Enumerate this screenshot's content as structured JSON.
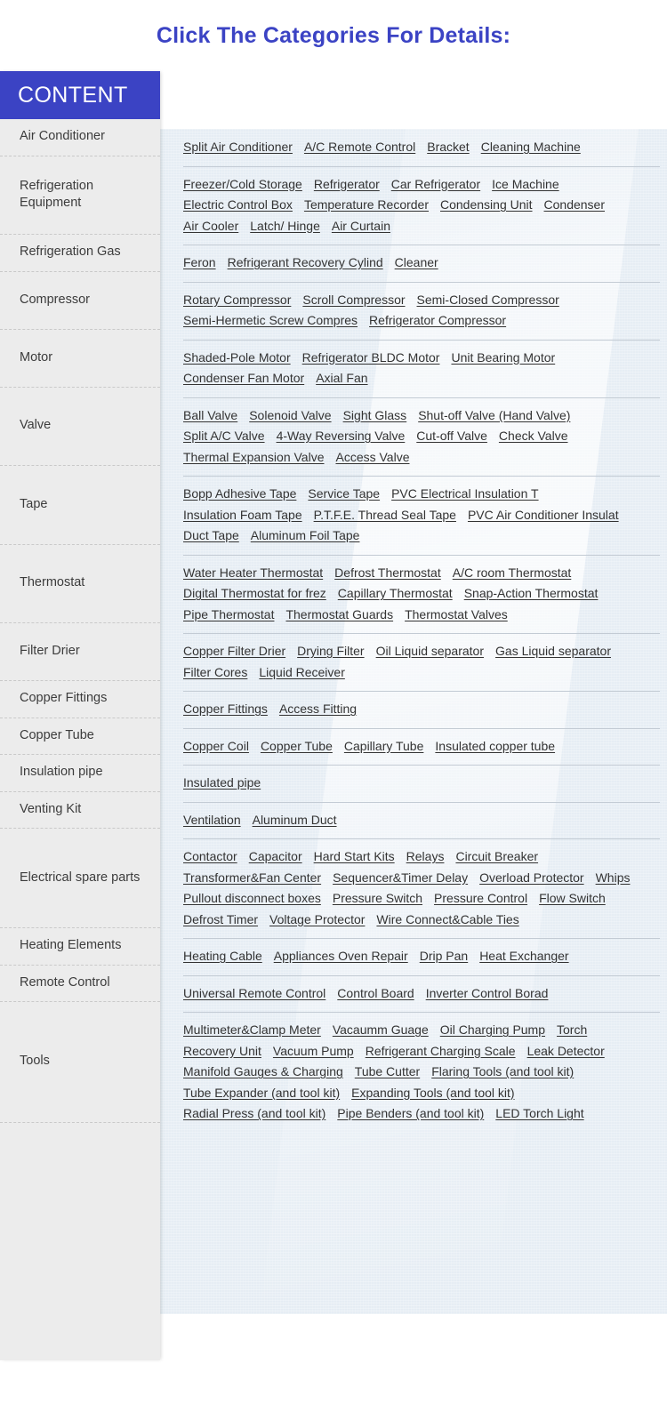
{
  "page": {
    "title": "Click The Categories For Details:",
    "accent_color": "#3b43c4",
    "sidebar_bg": "#ececec",
    "content_bg": "#e6edf4"
  },
  "sidebar": {
    "header": "CONTENT"
  },
  "categories": [
    {
      "label": "Air Conditioner",
      "links": [
        "Split Air Conditioner",
        "A/C Remote Control",
        "Bracket",
        "Cleaning Machine"
      ]
    },
    {
      "label": "Refrigeration Equipment",
      "links": [
        "Freezer/Cold Storage",
        "Refrigerator",
        "Car Refrigerator",
        "Ice Machine",
        "Electric Control Box",
        "Temperature Recorder",
        "Condensing Unit",
        "Condenser",
        "Air Cooler",
        "Latch/ Hinge",
        "Air Curtain"
      ]
    },
    {
      "label": "Refrigeration Gas",
      "links": [
        "Feron",
        "Refrigerant Recovery Cylind",
        "Cleaner"
      ]
    },
    {
      "label": "Compressor",
      "links": [
        "Rotary Compressor",
        "Scroll Compressor",
        "Semi-Closed Compressor",
        "Semi-Hermetic Screw Compres",
        "Refrigerator Compressor"
      ]
    },
    {
      "label": "Motor",
      "links": [
        "Shaded-Pole Motor",
        "Refrigerator BLDC Motor",
        "Unit Bearing Motor",
        "Condenser Fan Motor",
        "Axial Fan"
      ]
    },
    {
      "label": "Valve",
      "links": [
        "Ball Valve",
        "Solenoid Valve",
        "Sight Glass",
        "Shut-off Valve (Hand Valve)",
        "Split A/C Valve",
        "4-Way Reversing Valve",
        "Cut-off Valve",
        "Check Valve",
        "Thermal Expansion Valve",
        "Access Valve"
      ]
    },
    {
      "label": "Tape",
      "links": [
        "Bopp Adhesive Tape",
        "Service Tape",
        "PVC Electrical Insulation T",
        "Insulation Foam Tape",
        "P.T.F.E. Thread Seal Tape",
        "PVC Air Conditioner Insulat",
        "Duct Tape",
        "Aluminum Foil Tape"
      ]
    },
    {
      "label": "Thermostat",
      "links": [
        "Water Heater Thermostat",
        "Defrost Thermostat",
        "A/C room Thermostat",
        "Digital Thermostat for frez",
        "Capillary Thermostat",
        "Snap-Action Thermostat",
        "Pipe Thermostat",
        "Thermostat Guards",
        "Thermostat Valves"
      ]
    },
    {
      "label": "Filter Drier",
      "links": [
        "Copper Filter Drier",
        "Drying Filter",
        "Oil Liquid separator",
        "Gas Liquid separator",
        "Filter Cores",
        "Liquid Receiver"
      ]
    },
    {
      "label": "Copper Fittings",
      "links": [
        "Copper Fittings",
        "Access Fitting"
      ]
    },
    {
      "label": "Copper Tube",
      "links": [
        "Copper Coil",
        "Copper Tube",
        "Capillary Tube",
        "Insulated copper tube"
      ]
    },
    {
      "label": "Insulation pipe",
      "links": [
        "Insulated pipe"
      ]
    },
    {
      "label": "Venting Kit",
      "links": [
        "Ventilation",
        "Aluminum Duct"
      ]
    },
    {
      "label": "Electrical spare parts",
      "links": [
        "Contactor",
        "Capacitor",
        "Hard Start Kits",
        "Relays",
        "Circuit Breaker",
        "Transformer&Fan Center",
        "Sequencer&Timer Delay",
        "Overload Protector",
        "Whips",
        "Pullout disconnect boxes",
        "Pressure Switch",
        "Pressure Control",
        "Flow Switch",
        "Defrost Timer",
        "Voltage Protector",
        "Wire Connect&Cable Ties"
      ]
    },
    {
      "label": "Heating Elements",
      "links": [
        "Heating Cable",
        "Appliances Oven Repair",
        "Drip Pan",
        "Heat Exchanger"
      ]
    },
    {
      "label": "Remote Control",
      "links": [
        "Universal Remote Control",
        "Control Board",
        "Inverter Control Borad"
      ]
    },
    {
      "label": "Tools",
      "links": [
        "Multimeter&Clamp Meter",
        "Vacaumm Guage",
        "Oil Charging Pump",
        "Torch",
        "Recovery Unit",
        "Vacuum Pump",
        "Refrigerant Charging Scale",
        "Leak Detector",
        "Manifold Gauges & Charging",
        "Tube Cutter",
        "Flaring Tools (and tool kit)",
        "Tube Expander (and tool kit)",
        "Expanding Tools (and tool kit)",
        "Radial Press (and tool kit)",
        "Pipe Benders (and tool kit)",
        "LED Torch Light"
      ]
    }
  ]
}
